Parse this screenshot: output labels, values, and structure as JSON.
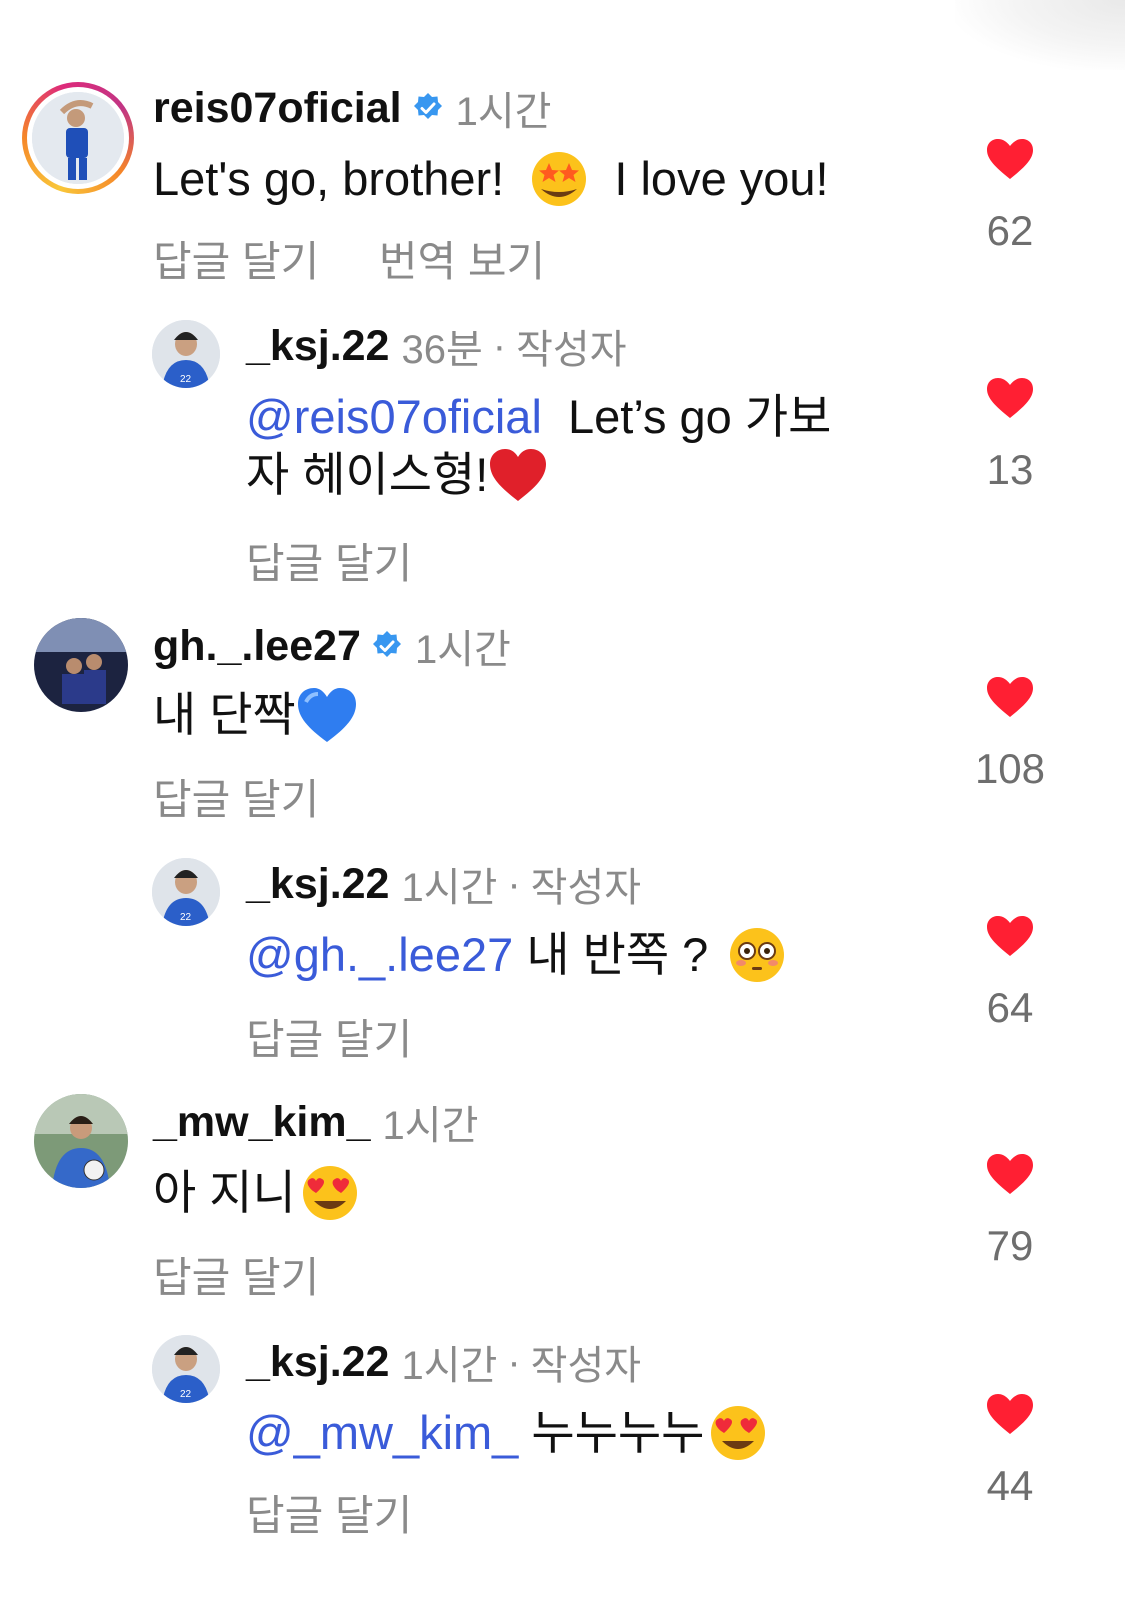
{
  "colors": {
    "mention": "#3a5bd9",
    "heart": "#ff1f33",
    "verified": "#3897f0",
    "secondary_text": "#8a8a8a"
  },
  "comments": [
    {
      "username": "reis07oficial",
      "verified": true,
      "time": "1시간",
      "text_lines": [
        "Let's go, brother!",
        "I love you!"
      ],
      "emoji": "star-struck-emoji",
      "actions": [
        "답글 달기",
        "번역 보기"
      ],
      "likes": "62",
      "story_ring": true
    },
    {
      "username": "_ksj.22",
      "time": "36분",
      "separator": "·",
      "author_tag": "작성자",
      "mention": "@reis07oficial",
      "text_lines": [
        "Let’s go 가보",
        "자 헤이스형!"
      ],
      "emoji": "red-heart-emoji",
      "actions": [
        "답글 달기"
      ],
      "likes": "13"
    },
    {
      "username": "gh._.lee27",
      "verified": true,
      "time": "1시간",
      "text_lines": [
        "내 단짝"
      ],
      "emoji": "blue-heart-emoji",
      "actions": [
        "답글 달기"
      ],
      "likes": "108"
    },
    {
      "username": "_ksj.22",
      "time": "1시간",
      "separator": "·",
      "author_tag": "작성자",
      "mention": "@gh._.lee27",
      "text_lines": [
        "내 반쪽 ?"
      ],
      "emoji": "flushed-face-emoji",
      "actions": [
        "답글 달기"
      ],
      "likes": "64"
    },
    {
      "username": "_mw_kim_",
      "time": "1시간",
      "text_lines": [
        "아 지니"
      ],
      "emoji": "heart-eyes-emoji",
      "actions": [
        "답글 달기"
      ],
      "likes": "79"
    },
    {
      "username": "_ksj.22",
      "time": "1시간",
      "separator": "·",
      "author_tag": "작성자",
      "mention": "@_mw_kim_",
      "text_lines": [
        "누누누누"
      ],
      "emoji": "heart-eyes-emoji",
      "actions": [
        "답글 달기"
      ],
      "likes": "44"
    }
  ]
}
